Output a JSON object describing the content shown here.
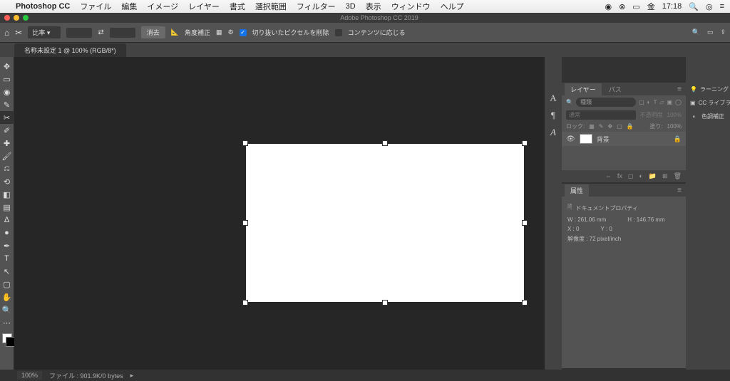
{
  "macbar": {
    "app": "Photoshop CC",
    "menus": [
      "ファイル",
      "編集",
      "イメージ",
      "レイヤー",
      "書式",
      "選択範囲",
      "フィルター",
      "3D",
      "表示",
      "ウィンドウ",
      "ヘルプ"
    ],
    "right": {
      "day": "金",
      "time": "17:18"
    }
  },
  "window": {
    "title": "Adobe Photoshop CC 2019"
  },
  "options": {
    "ratio_label": "比率",
    "clear": "消去",
    "straighten": "角度補正",
    "delete_cropped": "切り抜いたピクセルを削除",
    "content_aware": "コンテンツに応じる"
  },
  "tab": {
    "name": "名称未設定 1 @ 100% (RGB/8*)"
  },
  "tools": {
    "items": [
      "move",
      "marquee",
      "lasso",
      "quick-select",
      "crop",
      "eyedropper",
      "healing",
      "brush",
      "clone",
      "history",
      "eraser",
      "gradient",
      "blur",
      "dodge",
      "pen",
      "type",
      "path-select",
      "rectangle",
      "hand",
      "zoom"
    ],
    "glyphs": [
      "✥",
      "▭",
      "◉",
      "✎",
      "✂",
      "✐",
      "✚",
      "🖌",
      "⎌",
      "⟲",
      "◧",
      "▤",
      "∆",
      "●",
      "✒",
      "T",
      "↖",
      "▢",
      "✋",
      "🔍"
    ]
  },
  "side": {
    "type_glyphs": [
      "A",
      "¶",
      "A"
    ],
    "learning": "ラーニング",
    "cclib": "CC ライブラリ",
    "adjust": "色調補正"
  },
  "layers": {
    "tab1": "レイヤー",
    "tab2": "パス",
    "search_ph": "種類",
    "blend": "通常",
    "opacity_lbl": "不透明度",
    "opacity_val": "100%",
    "lock_lbl": "ロック:",
    "fill_lbl": "塗り:",
    "fill_val": "100%",
    "bg_name": "背景"
  },
  "props": {
    "tab": "属性",
    "doc_prop": "ドキュメントプロパティ",
    "w": "W : 261.06 mm",
    "h": "H : 146.76 mm",
    "x": "X : 0",
    "y": "Y : 0",
    "res": "解像度 : 72 pixel/inch"
  },
  "status": {
    "zoom": "100%",
    "filesize": "ファイル : 901.9K/0 bytes"
  }
}
